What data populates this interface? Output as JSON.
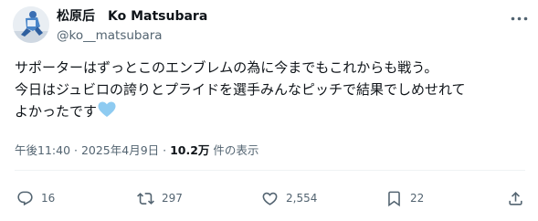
{
  "user": {
    "display_name": "松原后　Ko Matsubara",
    "handle": "@ko__matsubara"
  },
  "tweet": {
    "lines": [
      "サポーターはずっとこのエンブレムの為に今までもこれからも戦う。",
      "今日はジュビロの誇りとプライドを選手みんなピッチで結果でしめせれて",
      "よかったです"
    ],
    "emoji": "light-blue-heart"
  },
  "meta": {
    "timestamp": "午後11:40 · 2025年4月9日 · ",
    "views_count": "10.2万",
    "views_suffix": " 件の表示"
  },
  "actions": {
    "reply_count": "16",
    "repost_count": "297",
    "like_count": "2,554",
    "bookmark_count": "22"
  },
  "colors": {
    "text": "#0f1419",
    "secondary": "#536471",
    "divider": "#eff3f4",
    "heart": "#8ecbf1"
  },
  "icons": [
    "more-options-icon",
    "reply-icon",
    "repost-icon",
    "like-icon",
    "bookmark-icon",
    "share-icon"
  ]
}
